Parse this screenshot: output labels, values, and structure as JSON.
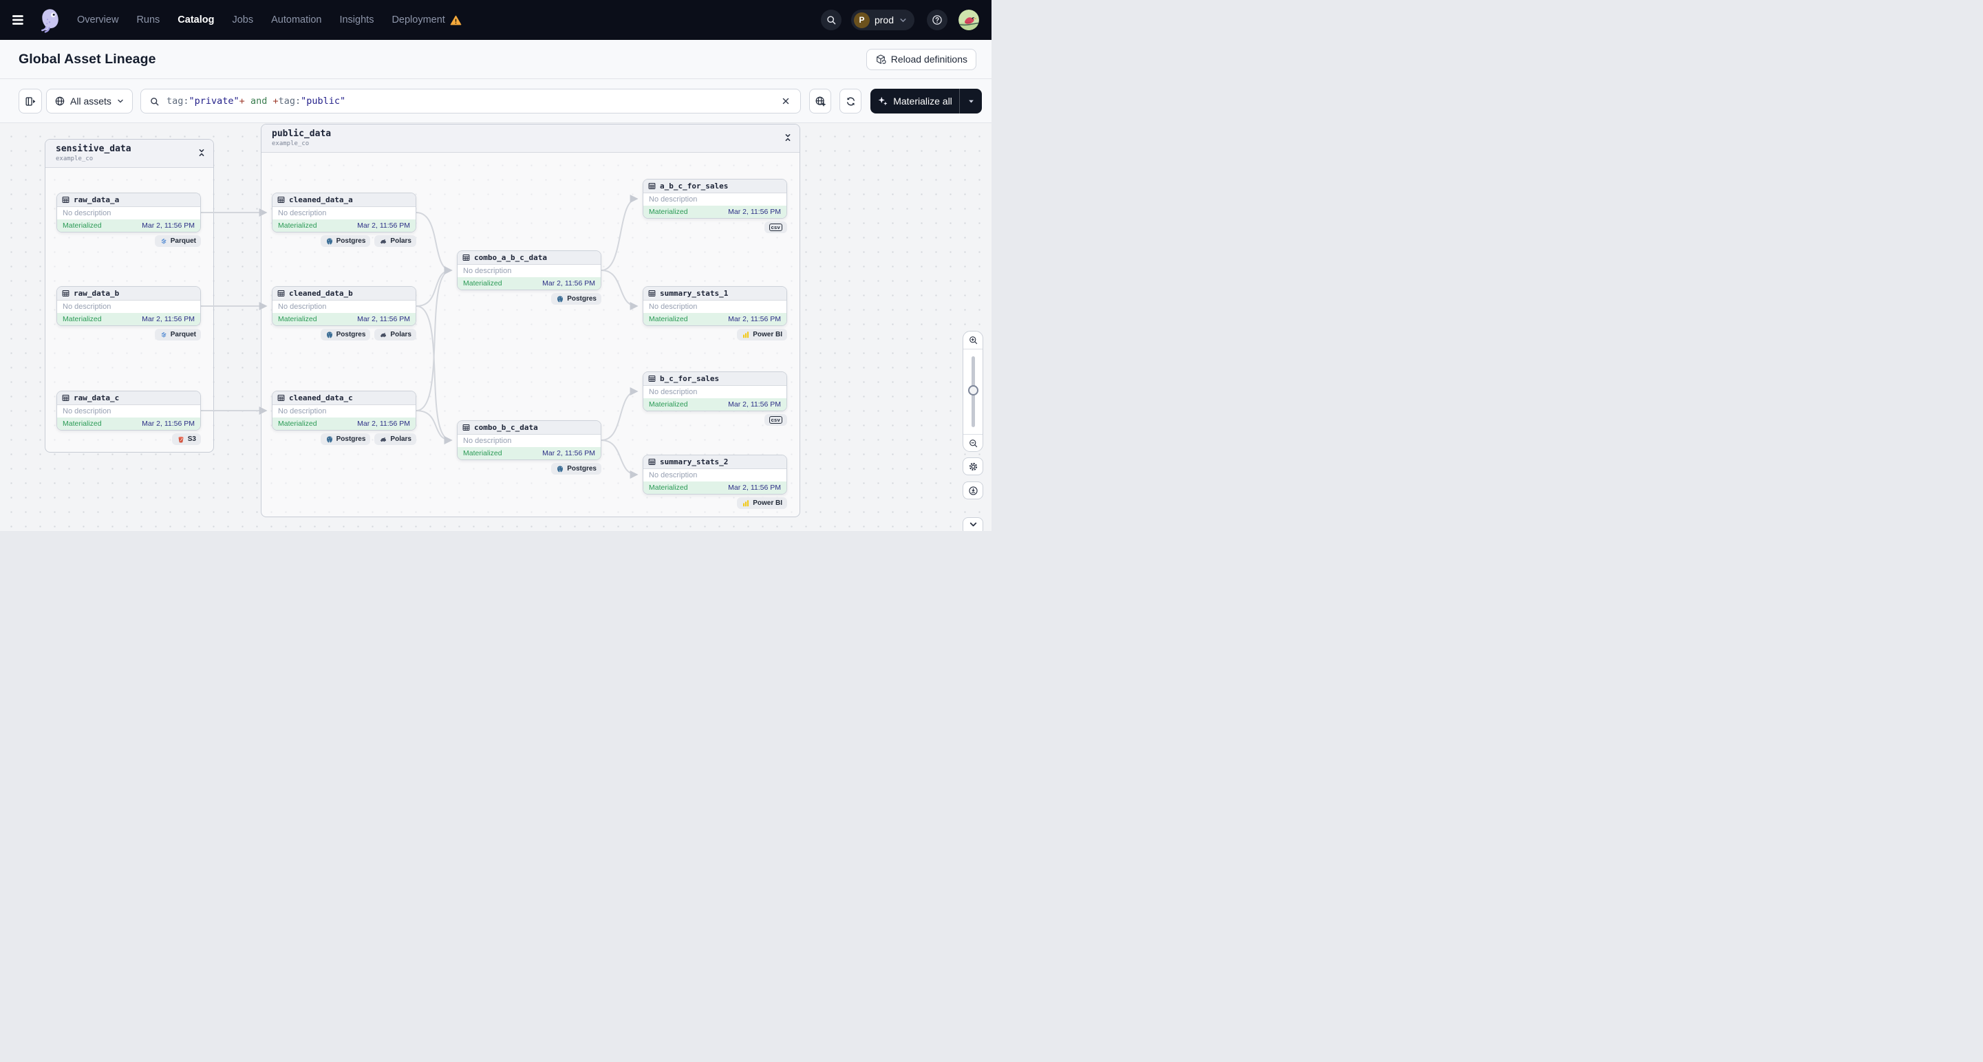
{
  "navbar": {
    "links": [
      {
        "label": "Overview"
      },
      {
        "label": "Runs"
      },
      {
        "label": "Catalog"
      },
      {
        "label": "Jobs"
      },
      {
        "label": "Automation"
      },
      {
        "label": "Insights"
      },
      {
        "label": "Deployment"
      }
    ],
    "environment": {
      "initial": "P",
      "name": "prod"
    }
  },
  "header": {
    "title": "Global Asset Lineage",
    "reload_button_label": "Reload definitions"
  },
  "toolbar": {
    "scope_label": "All assets",
    "materialize_label": "Materialize all",
    "query": {
      "k1": "tag:",
      "s1": "\"private\"",
      "p1": "+",
      "and": " and ",
      "p2": "+",
      "k2": "tag:",
      "s2": "\"public\""
    }
  },
  "graph": {
    "groups": [
      {
        "name": "sensitive_data",
        "location": "example_co"
      },
      {
        "name": "public_data",
        "location": "example_co"
      }
    ],
    "nodes": [
      {
        "name": "raw_data_a",
        "description": "No description",
        "status": "Materialized",
        "timestamp": "Mar 2, 11:56 PM",
        "badges": [
          {
            "label": "Parquet"
          }
        ]
      },
      {
        "name": "raw_data_b",
        "description": "No description",
        "status": "Materialized",
        "timestamp": "Mar 2, 11:56 PM",
        "badges": [
          {
            "label": "Parquet"
          }
        ]
      },
      {
        "name": "raw_data_c",
        "description": "No description",
        "status": "Materialized",
        "timestamp": "Mar 2, 11:56 PM",
        "badges": [
          {
            "label": "S3"
          }
        ]
      },
      {
        "name": "cleaned_data_a",
        "description": "No description",
        "status": "Materialized",
        "timestamp": "Mar 2, 11:56 PM",
        "badges": [
          {
            "label": "Postgres"
          },
          {
            "label": "Polars"
          }
        ]
      },
      {
        "name": "cleaned_data_b",
        "description": "No description",
        "status": "Materialized",
        "timestamp": "Mar 2, 11:56 PM",
        "badges": [
          {
            "label": "Postgres"
          },
          {
            "label": "Polars"
          }
        ]
      },
      {
        "name": "cleaned_data_c",
        "description": "No description",
        "status": "Materialized",
        "timestamp": "Mar 2, 11:56 PM",
        "badges": [
          {
            "label": "Postgres"
          },
          {
            "label": "Polars"
          }
        ]
      },
      {
        "name": "combo_a_b_c_data",
        "description": "No description",
        "status": "Materialized",
        "timestamp": "Mar 2, 11:56 PM",
        "badges": [
          {
            "label": "Postgres"
          }
        ]
      },
      {
        "name": "combo_b_c_data",
        "description": "No description",
        "status": "Materialized",
        "timestamp": "Mar 2, 11:56 PM",
        "badges": [
          {
            "label": "Postgres"
          }
        ]
      },
      {
        "name": "a_b_c_for_sales",
        "description": "No description",
        "status": "Materialized",
        "timestamp": "Mar 2, 11:56 PM",
        "badges": [
          {
            "label": "csv"
          }
        ]
      },
      {
        "name": "summary_stats_1",
        "description": "No description",
        "status": "Materialized",
        "timestamp": "Mar 2, 11:56 PM",
        "badges": [
          {
            "label": "Power BI"
          }
        ]
      },
      {
        "name": "b_c_for_sales",
        "description": "No description",
        "status": "Materialized",
        "timestamp": "Mar 2, 11:56 PM",
        "badges": [
          {
            "label": "csv"
          }
        ]
      },
      {
        "name": "summary_stats_2",
        "description": "No description",
        "status": "Materialized",
        "timestamp": "Mar 2, 11:56 PM",
        "badges": [
          {
            "label": "Power BI"
          }
        ]
      }
    ]
  },
  "colors": {
    "status_green": "#2a9a55",
    "timestamp_indigo": "#2c2f86",
    "warning_orange": "#f5a93c",
    "materialize_button_bg": "#111724",
    "navbar_bg": "#0b0e19"
  }
}
